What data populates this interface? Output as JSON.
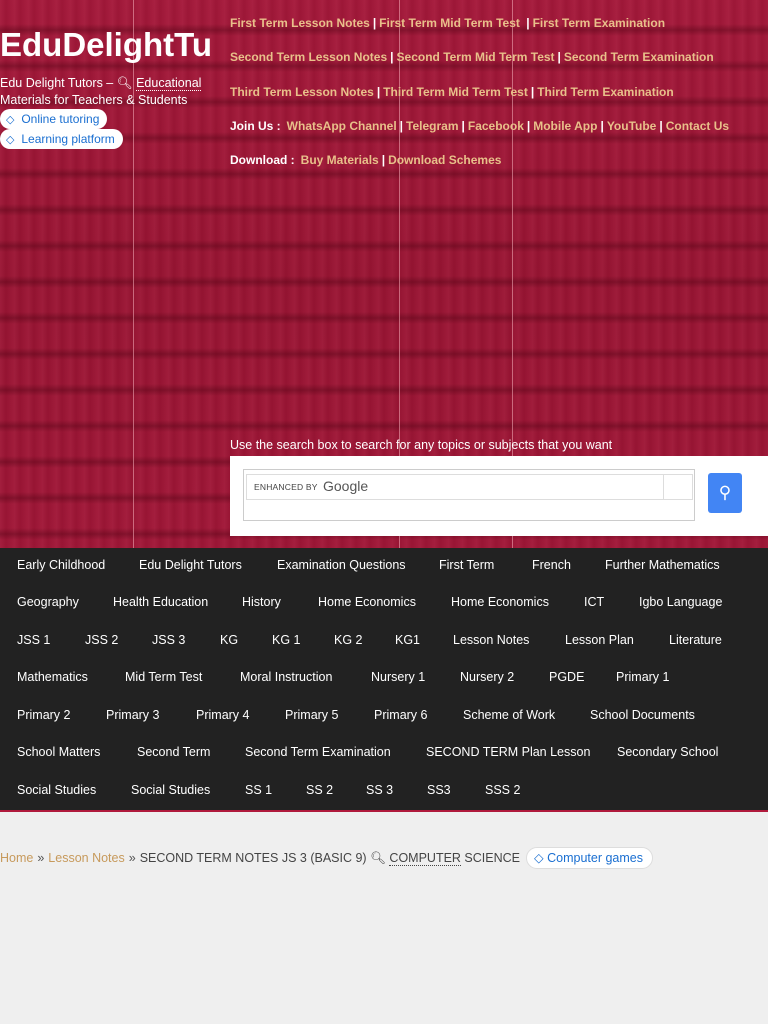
{
  "site": {
    "title": "EduDelightTu",
    "tagline_before": "Edu Delight Tutors – ",
    "tagline_link": "Educational",
    "tagline_after": " Materials for Teachers & Students",
    "pills": [
      "Online tutoring",
      "Learning platform"
    ]
  },
  "nav_links": {
    "row1": [
      "First Term Lesson Notes",
      "First Term Mid Term Test ",
      "First Term Examination"
    ],
    "row2": [
      "Second Term Lesson Notes",
      "Second Term Mid Term Test",
      "Second Term Examination"
    ],
    "row3": [
      "Third Term Lesson Notes",
      "Third Term Mid Term Test",
      "Third Term Examination"
    ],
    "join_label": "Join Us :",
    "row4": [
      "WhatsApp Channel",
      "Telegram",
      "Facebook",
      "Mobile App",
      "YouTube",
      "Contact Us"
    ],
    "download_label": "Download :",
    "row5": [
      "Buy Materials",
      "Download Schemes"
    ]
  },
  "search": {
    "hint": "Use the search box to search for any topics or subjects that you want",
    "enhanced_by": "ENHANCED BY",
    "google": "Google"
  },
  "categories": [
    [
      "Early Childhood",
      "Edu Delight Tutors",
      "Examination Questions",
      "First Term",
      "French",
      "Further Mathematics"
    ],
    [
      "Geography",
      "Health Education",
      "History",
      "Home Economics",
      "Home Economics",
      "ICT",
      "Igbo Language"
    ],
    [
      "JSS 1",
      "JSS 2",
      "JSS 3",
      "KG",
      "KG 1",
      "KG 2",
      "KG1",
      "Lesson Notes",
      "Lesson Plan",
      "Literature"
    ],
    [
      "Mathematics",
      "Mid Term Test",
      "Moral Instruction",
      "Nursery 1",
      "Nursery 2",
      "PGDE",
      "Primary 1"
    ],
    [
      "Primary 2",
      "Primary 3",
      "Primary 4",
      "Primary 5",
      "Primary 6",
      "Scheme of Work",
      "School Documents"
    ],
    [
      "School Matters",
      "Second Term",
      "Second Term Examination",
      "SECOND TERM Plan Lesson",
      "Secondary School"
    ],
    [
      "Social Studies",
      "Social Studies",
      "SS 1",
      "SS 2",
      "SS 3",
      "SS3",
      "SSS 2"
    ]
  ],
  "breadcrumb": {
    "home": "Home",
    "lesson_notes": "Lesson Notes",
    "current_prefix": "SECOND TERM NOTES JS 3 (BASIC 9) ",
    "current_link": "COMPUTER",
    "current_suffix": " SCIENCE",
    "pill": "Computer games"
  },
  "colors": {
    "header_bg": "#a1163a",
    "link_gold": "#e8c08a",
    "nav_bg": "#222222",
    "pill_text": "#1a6fd1",
    "search_btn": "#4285f4"
  },
  "icons": [
    "search-icon",
    "tag-icon",
    "chevrons-right-icon"
  ]
}
